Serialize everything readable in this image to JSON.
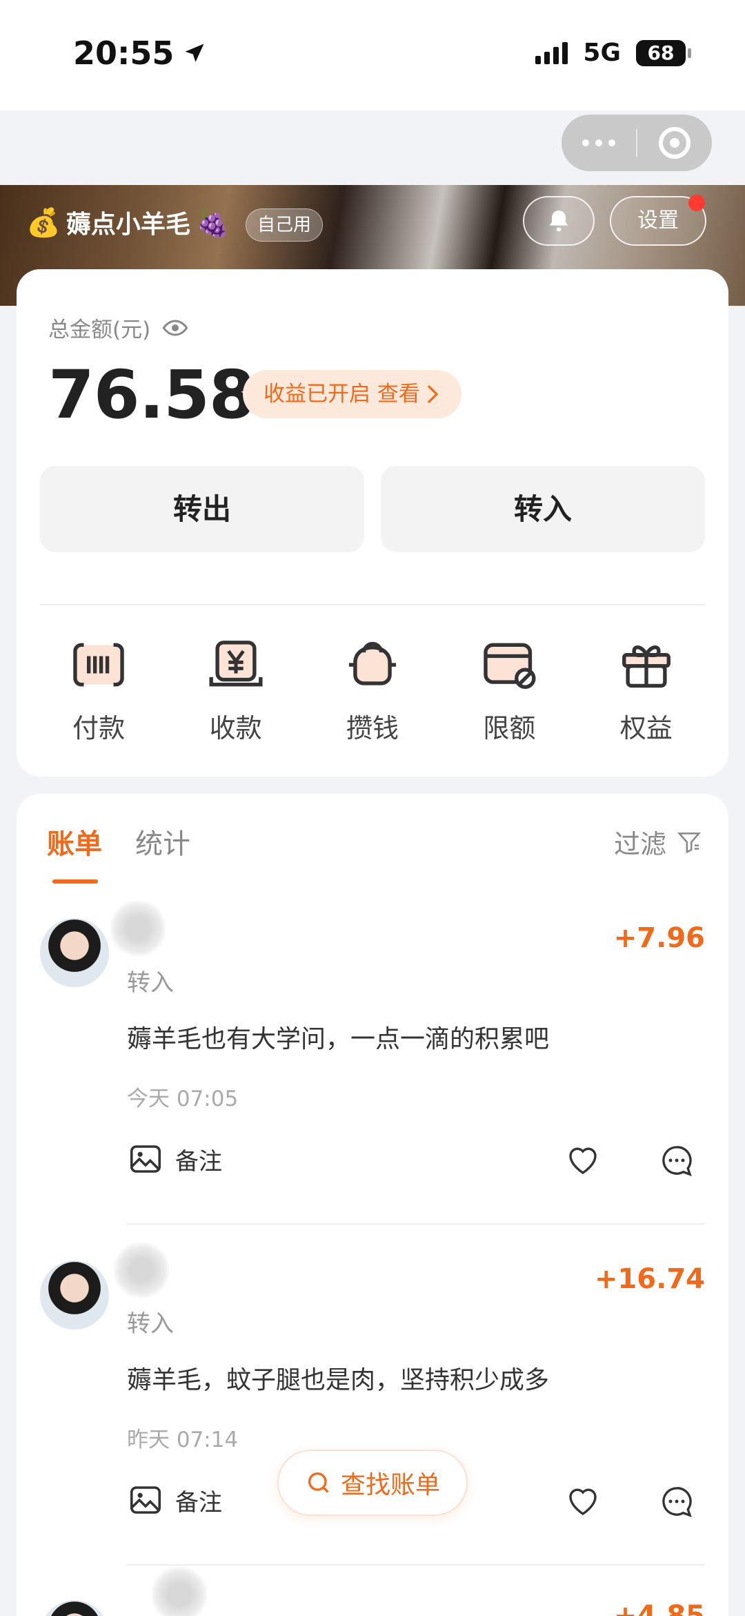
{
  "status": {
    "time": "20:55",
    "network": "5G",
    "battery": "68"
  },
  "header": {
    "brand_name": "薅点小羊毛",
    "brand_prefix_emoji": "💰",
    "brand_suffix_emoji": "🍇",
    "tag": "自己用",
    "settings": "设置"
  },
  "balance": {
    "label": "总金额(元)",
    "amount": "76.58",
    "yield_text": "收益已开启 查看",
    "transfer_out": "转出",
    "transfer_in": "转入"
  },
  "actions": [
    {
      "label": "付款",
      "icon": "barcode-icon"
    },
    {
      "label": "收款",
      "icon": "receive-yuan-icon"
    },
    {
      "label": "攒钱",
      "icon": "piggy-bank-icon"
    },
    {
      "label": "限额",
      "icon": "card-limit-icon"
    },
    {
      "label": "权益",
      "icon": "gift-icon"
    }
  ],
  "tabs": {
    "bill": "账单",
    "stats": "统计",
    "filter": "过滤"
  },
  "transactions": [
    {
      "type": "转入",
      "amount": "+7.96",
      "message": "薅羊毛也有大学问，一点一滴的积累吧",
      "time": "今天 07:05",
      "note_label": "备注"
    },
    {
      "type": "转入",
      "amount": "+16.74",
      "message": "薅羊毛，蚊子腿也是肉，坚持积少成多",
      "time": "昨天 07:14",
      "note_label": "备注"
    },
    {
      "amount": "+4.85"
    }
  ],
  "search_bill": "查找账单",
  "colors": {
    "accent": "#f06a1a",
    "accent_bg": "#fde9dc",
    "badge_red": "#ff3b30"
  }
}
